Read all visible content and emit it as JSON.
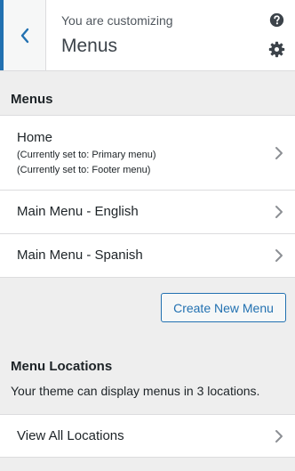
{
  "header": {
    "customizing_label": "You are customizing",
    "section_title": "Menus",
    "back_icon": "chevron-left-icon",
    "help_icon": "help-icon",
    "settings_icon": "gear-icon",
    "accent_color": "#2271b1"
  },
  "menus_section": {
    "heading": "Menus",
    "items": [
      {
        "name": "Home",
        "locations": [
          "(Currently set to: Primary menu)",
          "(Currently set to: Footer menu)"
        ]
      },
      {
        "name": "Main Menu - English"
      },
      {
        "name": "Main Menu - Spanish"
      }
    ],
    "create_button_label": "Create New Menu"
  },
  "locations_section": {
    "heading": "Menu Locations",
    "description": "Your theme can display menus in 3 locations.",
    "view_all_label": "View All Locations"
  }
}
